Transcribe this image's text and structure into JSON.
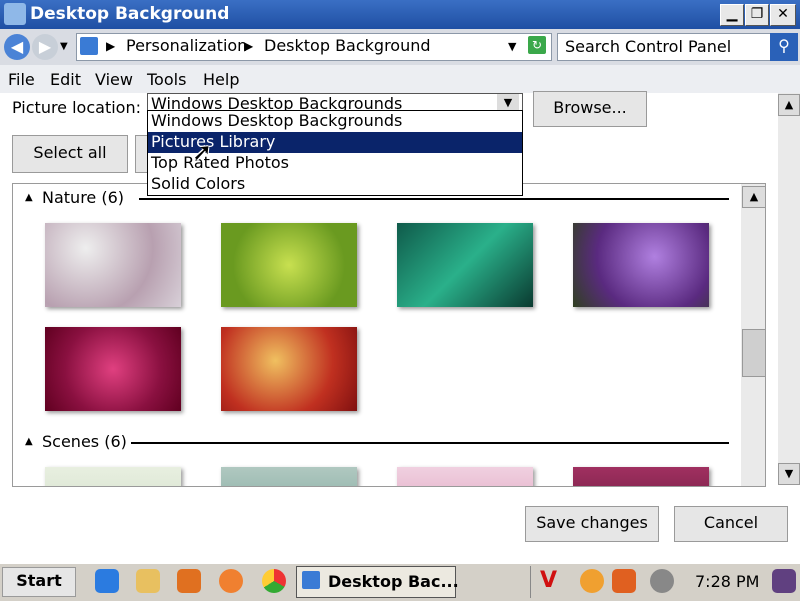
{
  "window": {
    "title": "Desktop Background",
    "minimize_icon": "minimize-icon",
    "restore_icon": "restore-icon",
    "close_icon": "close-icon"
  },
  "address": {
    "breadcrumb": [
      "Personalization",
      "Desktop Background"
    ],
    "separator": "▶",
    "search_placeholder": "Search Control Panel"
  },
  "menu": [
    "File",
    "Edit",
    "View",
    "Tools",
    "Help"
  ],
  "picture_location": {
    "label": "Picture location:",
    "value": "Windows Desktop Backgrounds",
    "browse_label": "Browse...",
    "options": [
      "Windows Desktop Backgrounds",
      "Pictures Library",
      "Top Rated Photos",
      "Solid Colors"
    ],
    "highlighted": "Pictures Library"
  },
  "select_all_label": "Select all",
  "sections": [
    {
      "title": "Nature (6)",
      "colors": [
        "#d6c9d1",
        "#9cc23a",
        "#1f8a6a",
        "#8a5ab0",
        "#b0205a",
        "#c8502a"
      ]
    },
    {
      "title": "Scenes (6)",
      "colors": [
        "#dfe6da",
        "#8fb4a8",
        "#e0a8c0",
        "#8a2a5a"
      ]
    }
  ],
  "buttons": {
    "save": "Save changes",
    "cancel": "Cancel"
  },
  "taskbar": {
    "start_label": "Start",
    "active_task": "Desktop Bac...",
    "time": "7:28 PM"
  }
}
